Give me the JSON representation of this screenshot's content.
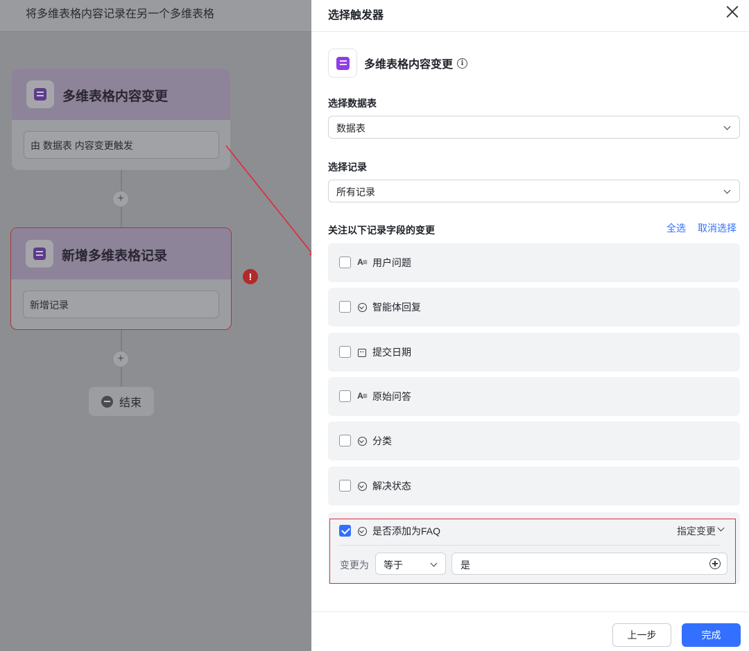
{
  "canvas": {
    "title": "将多维表格内容记录在另一个多维表格",
    "trigger_node": {
      "title": "多维表格内容变更",
      "icon": "bitable-icon",
      "body": "由 数据表 内容变更触发"
    },
    "action_node": {
      "title": "新增多维表格记录",
      "icon": "bitable-icon",
      "body": "新增记录",
      "error_mark": "!"
    },
    "add_step": "+",
    "end_node": {
      "label": "结束"
    }
  },
  "drawer": {
    "title": "选择触发器",
    "trigger": {
      "name": "多维表格内容变更",
      "info": "i",
      "icon": "bitable-icon"
    },
    "table_select": {
      "label": "选择数据表",
      "value": "数据表"
    },
    "record_select": {
      "label": "选择记录",
      "value": "所有记录"
    },
    "fields_section": {
      "label": "关注以下记录字段的变更",
      "select_all": "全选",
      "deselect": "取消选择",
      "fields": [
        {
          "type": "text",
          "type_glyph": "A≡",
          "name": "用户问题",
          "checked": false
        },
        {
          "type": "single-select",
          "name": "智能体回复",
          "checked": false
        },
        {
          "type": "date",
          "name": "提交日期",
          "checked": false
        },
        {
          "type": "text",
          "type_glyph": "A≡",
          "name": "原始问答",
          "checked": false
        },
        {
          "type": "single-select",
          "name": "分类",
          "checked": false
        },
        {
          "type": "single-select",
          "name": "解决状态",
          "checked": false
        }
      ],
      "faq_field": {
        "type": "single-select",
        "name": "是否添加为FAQ",
        "checked": true,
        "mode": "指定变更",
        "condition_label": "变更为",
        "operator": "等于",
        "value": "是"
      }
    },
    "footer": {
      "prev": "上一步",
      "done": "完成"
    }
  },
  "colors": {
    "accent": "#3370ff",
    "highlight_border": "#e0283a",
    "error": "#b12a2c",
    "bitable_purple": "#8f3ee3"
  }
}
